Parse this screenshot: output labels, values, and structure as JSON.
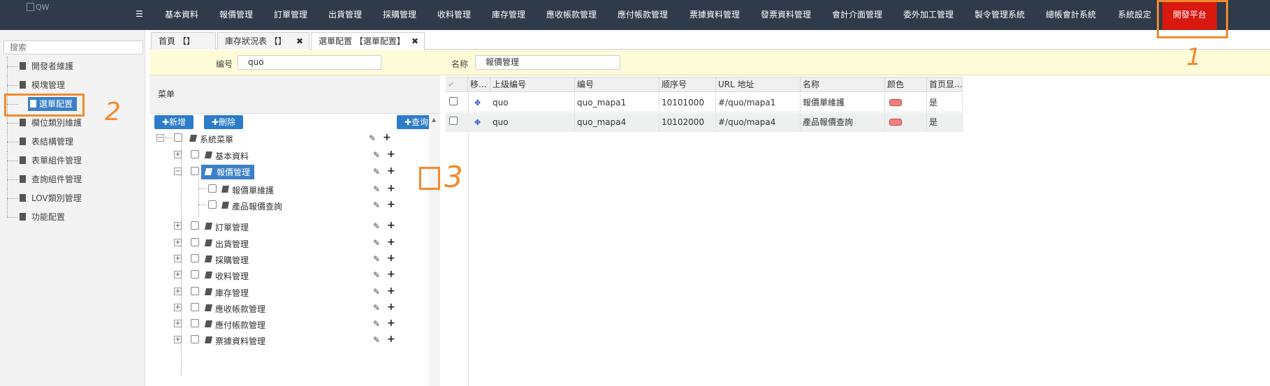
{
  "header": {
    "logo_alt": "QW",
    "menu_icon": "list-icon",
    "nav_items": [
      {
        "label": "基本資料"
      },
      {
        "label": "報價管理"
      },
      {
        "label": "訂單管理"
      },
      {
        "label": "出貨管理"
      },
      {
        "label": "採購管理"
      },
      {
        "label": "收料管理"
      },
      {
        "label": "庫存管理"
      },
      {
        "label": "應收帳款管理"
      },
      {
        "label": "應付帳款管理"
      },
      {
        "label": "票據資料管理"
      },
      {
        "label": "發票資料管理"
      },
      {
        "label": "會計介面管理"
      },
      {
        "label": "委外加工管理"
      },
      {
        "label": "製令管理系統"
      },
      {
        "label": "總帳會計系統"
      },
      {
        "label": "系統設定"
      },
      {
        "label": "開發平台",
        "active": true
      }
    ],
    "active_color": "#d9190f",
    "bg_color": "#2f3a4a"
  },
  "sidebar": {
    "search_placeholder": "搜索",
    "items": [
      {
        "label": "開發者維護"
      },
      {
        "label": "模塊管理"
      },
      {
        "label": "選單配置",
        "selected": true
      },
      {
        "label": "欄位類別維護"
      },
      {
        "label": "表結構管理"
      },
      {
        "label": "表單組件管理"
      },
      {
        "label": "查詢組件管理"
      },
      {
        "label": "LOV類別管理"
      },
      {
        "label": "功能配置"
      }
    ]
  },
  "tabs": [
    {
      "label": "首頁 【】"
    },
    {
      "label": "庫存狀況表 【】",
      "close": "✖"
    },
    {
      "label": "選單配置 【選單配置】",
      "close": "✖",
      "active": true
    }
  ],
  "form": {
    "code_label": "编号",
    "code_value": "quo",
    "name_label": "名称",
    "name_value": "報價管理"
  },
  "tree_panel": {
    "title": "菜单",
    "add_button": "✚新增",
    "delete_button": "✚刪除",
    "query_button": "✚查询",
    "root": "系統菜單",
    "nodes": [
      {
        "label": "基本資料",
        "expander": "+"
      },
      {
        "label": "報價管理",
        "expander": "−",
        "selected": true
      },
      {
        "label": "報價單維護",
        "child": true
      },
      {
        "label": "產品報價查詢",
        "child": true
      },
      {
        "label": "訂單管理",
        "expander": "+"
      },
      {
        "label": "出貨管理",
        "expander": "+"
      },
      {
        "label": "採購管理",
        "expander": "+"
      },
      {
        "label": "收料管理",
        "expander": "+"
      },
      {
        "label": "庫存管理",
        "expander": "+"
      },
      {
        "label": "應收帳款管理",
        "expander": "+"
      },
      {
        "label": "應付帳款管理",
        "expander": "+"
      },
      {
        "label": "票據資料管理",
        "expander": "+"
      }
    ]
  },
  "grid": {
    "headers": [
      "",
      "移...",
      "上级编号",
      "编号",
      "顺序号",
      "URL 地址",
      "名称",
      "颜色",
      "首页显..."
    ],
    "rows": [
      {
        "parent": "quo",
        "code": "quo_mapa1",
        "order": "10101000",
        "url": "#/quo/mapa1",
        "name": "報價單維護",
        "color": "#f08080",
        "home": "是"
      },
      {
        "parent": "quo",
        "code": "quo_mapa4",
        "order": "10102000",
        "url": "#/quo/mapa4",
        "name": "產品報價查詢",
        "color": "#f08080",
        "home": "是"
      }
    ]
  },
  "annotations": {
    "one": "1",
    "two": "2",
    "three": "3",
    "color": "#f28a2d"
  }
}
